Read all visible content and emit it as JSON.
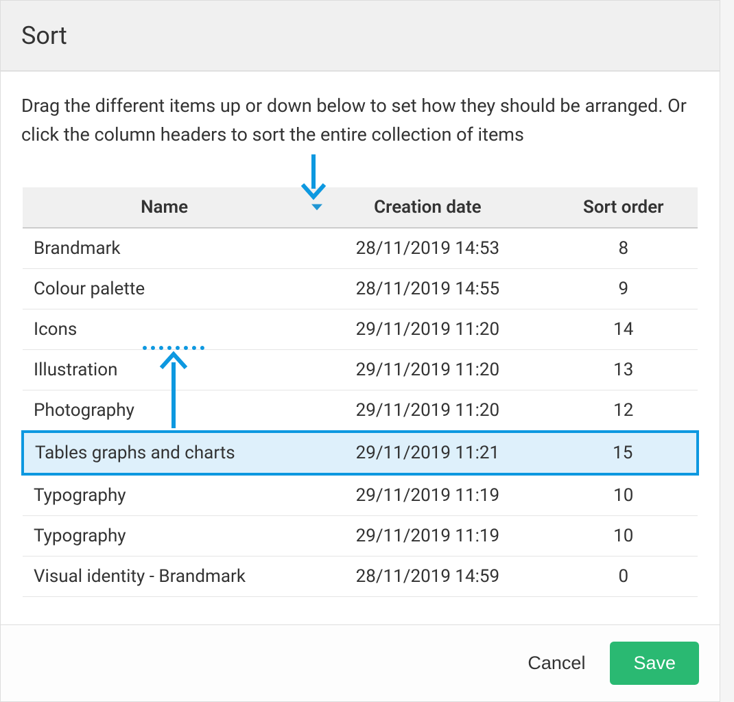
{
  "dialog": {
    "title": "Sort",
    "instructions": "Drag the different items up or down below to set how they should be arranged. Or click the column headers to sort the entire collection of items"
  },
  "table": {
    "headers": {
      "name": "Name",
      "creation_date": "Creation date",
      "sort_order": "Sort order"
    },
    "rows": [
      {
        "name": "Brandmark",
        "creation_date": "28/11/2019 14:53",
        "sort_order": "8",
        "highlighted": false
      },
      {
        "name": "Colour palette",
        "creation_date": "28/11/2019 14:55",
        "sort_order": "9",
        "highlighted": false
      },
      {
        "name": "Icons",
        "creation_date": "29/11/2019 11:20",
        "sort_order": "14",
        "highlighted": false
      },
      {
        "name": "Illustration",
        "creation_date": "29/11/2019 11:20",
        "sort_order": "13",
        "highlighted": false
      },
      {
        "name": "Photography",
        "creation_date": "29/11/2019 11:20",
        "sort_order": "12",
        "highlighted": false
      },
      {
        "name": "Tables graphs and charts",
        "creation_date": "29/11/2019 11:21",
        "sort_order": "15",
        "highlighted": true
      },
      {
        "name": "Typography",
        "creation_date": "29/11/2019 11:19",
        "sort_order": "10",
        "highlighted": false
      },
      {
        "name": "Typography",
        "creation_date": "29/11/2019 11:19",
        "sort_order": "10",
        "highlighted": false
      },
      {
        "name": "Visual identity - Brandmark",
        "creation_date": "28/11/2019 14:59",
        "sort_order": "0",
        "highlighted": false
      }
    ]
  },
  "footer": {
    "cancel_label": "Cancel",
    "save_label": "Save"
  },
  "colors": {
    "accent": "#0d98e0",
    "save_button": "#2ab972",
    "highlight_bg": "#def0fb"
  }
}
